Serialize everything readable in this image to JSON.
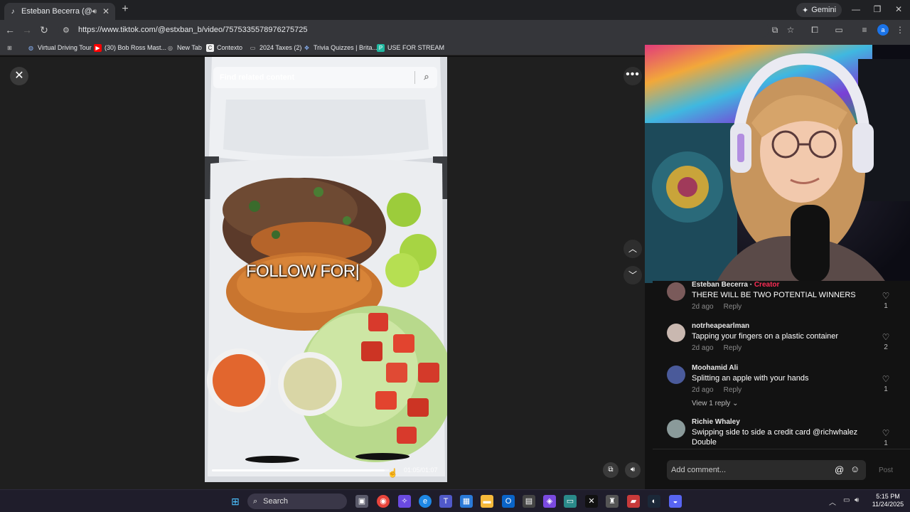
{
  "browser": {
    "tab_title": "Esteban Becerra (@estxban",
    "url": "https://www.tiktok.com/@estxban_b/video/7575335578976275725",
    "gemini_label": "Gemini",
    "bookmarks": [
      {
        "label": "Virtual Driving Tour",
        "icon": "globe-icon"
      },
      {
        "label": "(30) Bob Ross Mast...",
        "icon": "youtube-icon"
      },
      {
        "label": "New Tab",
        "icon": "chrome-icon"
      },
      {
        "label": "Contexto",
        "icon": "contexto-icon"
      },
      {
        "label": "2024 Taxes (2)",
        "icon": "folder-icon"
      },
      {
        "label": "Trivia Quizzes | Brita...",
        "icon": "britannica-icon"
      },
      {
        "label": "USE FOR STREAM",
        "icon": "p-icon"
      }
    ]
  },
  "video": {
    "search_placeholder": "Find related content",
    "overlay_text": "FOLLOW FOR|",
    "timecode": "01:05/01:07",
    "progress": 0.97
  },
  "comments": [
    {
      "name": "Esteban Becerra",
      "separator": " · ",
      "badge": "Creator",
      "text": "THERE WILL BE TWO POTENTIAL WINNERS",
      "age": "2d ago",
      "reply": "Reply",
      "likes": "1"
    },
    {
      "name": "notrheapearlman",
      "text": "Tapping your fingers on a plastic container",
      "age": "2d ago",
      "reply": "Reply",
      "likes": "2"
    },
    {
      "name": "Moohamid Ali",
      "text": "Splitting an apple with your hands",
      "age": "2d ago",
      "reply": "Reply",
      "likes": "1",
      "view_replies": "View 1 reply"
    },
    {
      "name": "Richie Whaley",
      "text": "Swipping side to side a credit card @richwhalez Double",
      "likes": "1"
    }
  ],
  "composer": {
    "placeholder": "Add comment...",
    "post_label": "Post"
  },
  "taskbar": {
    "search_label": "Search",
    "time": "5:15 PM",
    "date": "11/24/2025"
  },
  "colors": {
    "creator_badge": "#fe2c55",
    "background": "#121212"
  }
}
